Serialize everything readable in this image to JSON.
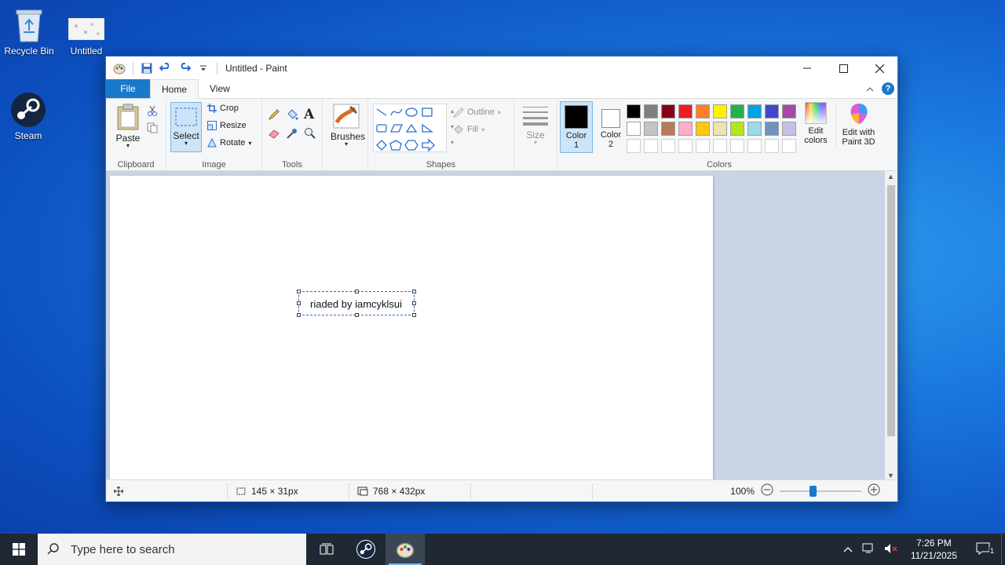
{
  "desktop": {
    "icons": [
      {
        "label": "Recycle Bin"
      },
      {
        "label": "Untitled"
      },
      {
        "label": "Steam"
      }
    ]
  },
  "window": {
    "title": "Untitled - Paint",
    "tabs": [
      "File",
      "Home",
      "View"
    ],
    "ribbon": {
      "clipboard": {
        "paste": "Paste",
        "group": "Clipboard"
      },
      "image": {
        "select": "Select",
        "crop": "Crop",
        "resize": "Resize",
        "rotate": "Rotate",
        "group": "Image"
      },
      "tools": {
        "group": "Tools"
      },
      "brushes": {
        "label": "Brushes"
      },
      "shapes": {
        "outline": "Outline",
        "fill": "Fill",
        "group": "Shapes"
      },
      "size": {
        "label": "Size"
      },
      "colors": {
        "color1": "Color",
        "color1_num": "1",
        "color2": "Color",
        "color2_num": "2",
        "edit": "Edit",
        "edit2": "colors",
        "paint3d": "Edit with",
        "paint3d2": "Paint 3D",
        "group": "Colors",
        "palette_row1": [
          "#000000",
          "#7f7f7f",
          "#880015",
          "#ed1c24",
          "#ff7f27",
          "#fff200",
          "#22b14c",
          "#00a2e8",
          "#3f48cc",
          "#a349a4"
        ],
        "palette_row2": [
          "#ffffff",
          "#c3c3c3",
          "#b97a57",
          "#ffaec9",
          "#ffc90e",
          "#efe4b0",
          "#b5e61d",
          "#99d9ea",
          "#7092be",
          "#c8bfe7"
        ]
      }
    },
    "canvas": {
      "text": "riaded by iamcyklsui"
    },
    "status": {
      "selection_size": "145 × 31px",
      "canvas_size": "768 × 432px",
      "zoom": "100%"
    }
  },
  "taskbar": {
    "search_placeholder": "Type here to search",
    "time": "7:26 PM",
    "date": "11/21/2025",
    "notifications": "1"
  }
}
